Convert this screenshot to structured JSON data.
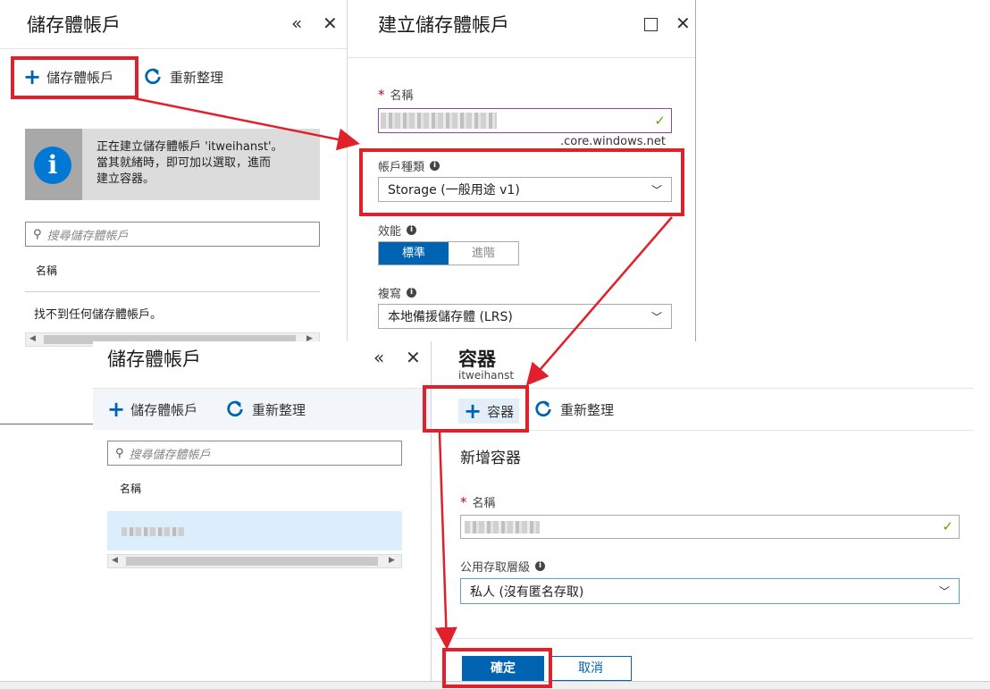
{
  "blade1": {
    "title": "儲存體帳戶",
    "collapse_icon": "«",
    "close_icon": "✕",
    "toolbar": {
      "add_label": "儲存體帳戶",
      "refresh_label": "重新整理"
    },
    "info": {
      "line1": "正在建立儲存體帳戶 'itweihanst'。",
      "line2": "當其就緒時，即可加以選取，進而",
      "line3": "建立容器。"
    },
    "search_placeholder": "搜尋儲存體帳戶",
    "column_name": "名稱",
    "empty_text": "找不到任何儲存體帳戶。"
  },
  "blade2": {
    "title": "建立儲存體帳戶",
    "name_label": "名稱",
    "domain_suffix": ".core.windows.net",
    "account_type_label": "帳戶種類",
    "account_type_value": "Storage (一般用途 v1)",
    "performance_label": "效能",
    "performance_options": [
      "標準",
      "進階"
    ],
    "replication_label": "複寫",
    "replication_value": "本地備援儲存體 (LRS)"
  },
  "blade3": {
    "title": "儲存體帳戶",
    "collapse_icon": "«",
    "close_icon": "✕",
    "toolbar": {
      "add_label": "儲存體帳戶",
      "refresh_label": "重新整理"
    },
    "search_placeholder": "搜尋儲存體帳戶",
    "column_name": "名稱"
  },
  "blade4": {
    "title": "容器",
    "subtitle": "itweihanst",
    "toolbar": {
      "add_label": "容器",
      "refresh_label": "重新整理"
    },
    "section_title": "新增容器",
    "name_label": "名稱",
    "access_label": "公用存取層級",
    "access_value": "私人 (沒有匿名存取)",
    "ok_label": "確定",
    "cancel_label": "取消"
  },
  "colors": {
    "accent": "#0063b1",
    "highlight_red": "#e0202a",
    "info_bg": "#dcdcdc",
    "selected_row": "#dbeefb"
  }
}
